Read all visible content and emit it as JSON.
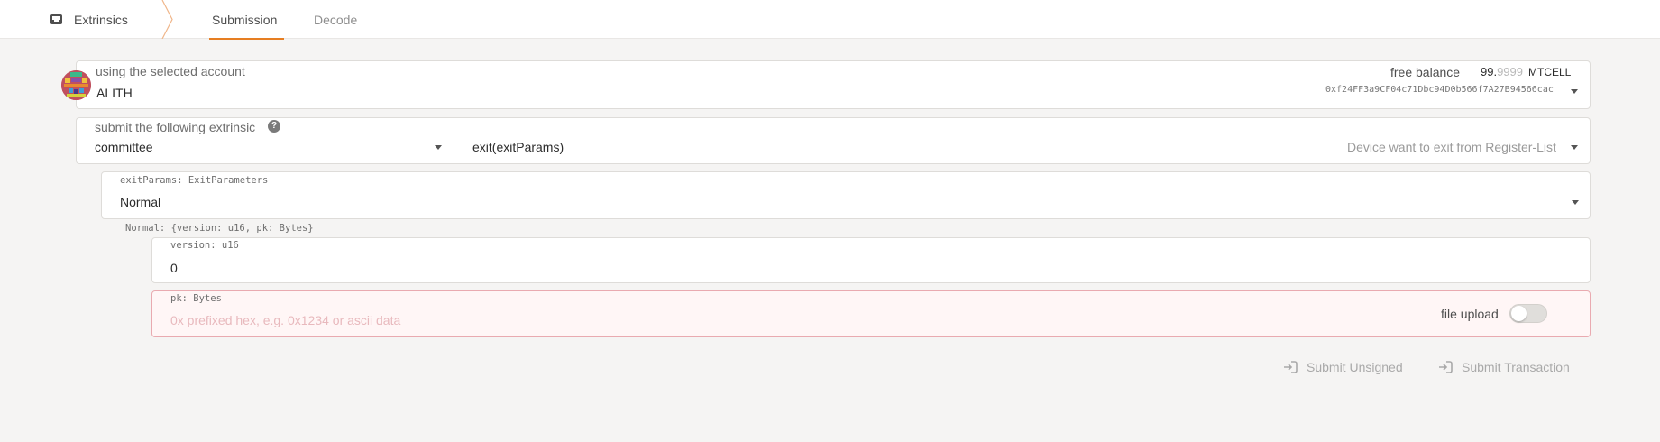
{
  "nav": {
    "section": "Extrinsics",
    "tabs": [
      {
        "label": "Submission"
      },
      {
        "label": "Decode"
      }
    ]
  },
  "account": {
    "label": "using the selected account",
    "name": "ALITH",
    "balance_label": "free balance",
    "balance_int": "99.",
    "balance_frac": "9999",
    "balance_unit": "MTCELL",
    "address": "0xf24FF3a9CF04c71Dbc94D0b566f7A27B94566cac"
  },
  "extrinsic": {
    "label": "submit the following extrinsic",
    "pallet": "committee",
    "method": "exit(exitParams)",
    "description": "Device want to exit from Register-List"
  },
  "exit_params": {
    "label": "exitParams: ExitParameters",
    "value": "Normal",
    "struct_hint": "Normal: {version: u16, pk: Bytes}"
  },
  "version_field": {
    "label": "version: u16",
    "value": "0"
  },
  "pk_field": {
    "label": "pk: Bytes",
    "placeholder": "0x prefixed hex, e.g. 0x1234 or ascii data",
    "file_upload_label": "file upload",
    "file_upload_enabled": false
  },
  "actions": {
    "submit_unsigned": "Submit Unsigned",
    "submit_transaction": "Submit Transaction"
  },
  "colors": {
    "accent": "#e67e22",
    "error_border": "#e9aab0",
    "error_bg": "#fff6f6"
  }
}
